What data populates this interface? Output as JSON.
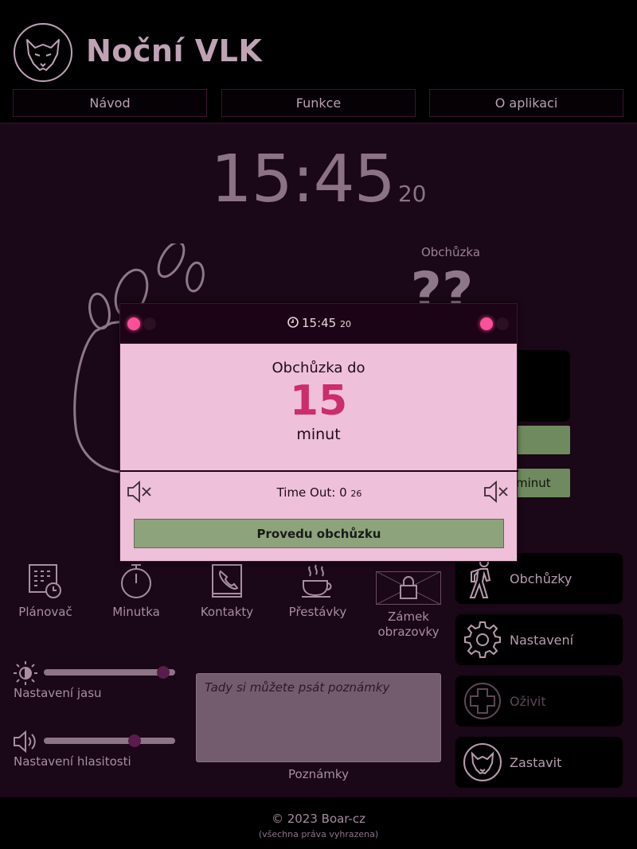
{
  "app": {
    "title": "Noční VLK"
  },
  "nav": [
    {
      "label": "Návod"
    },
    {
      "label": "Funkce"
    },
    {
      "label": "O aplikaci"
    }
  ],
  "clock": {
    "hm": "15:45",
    "sec": "20"
  },
  "obchuzka": {
    "label": "Obchůzka",
    "value": "??"
  },
  "behind_modal": {
    "minut_fragment": "minut"
  },
  "tools": [
    {
      "label": "Plánovač",
      "icon": "calendar-clock-icon"
    },
    {
      "label": "Minutka",
      "icon": "stopwatch-icon"
    },
    {
      "label": "Kontakty",
      "icon": "phone-book-icon"
    },
    {
      "label": "Přestávky",
      "icon": "coffee-cup-icon"
    },
    {
      "label": "Zámek obrazovky",
      "icon": "lock-icon"
    }
  ],
  "side_buttons": [
    {
      "label": "Obchůzky",
      "icon": "walking-person-icon"
    },
    {
      "label": "Nastavení",
      "icon": "gear-icon"
    },
    {
      "label": "Oživit",
      "icon": "medical-cross-icon",
      "disabled": true
    },
    {
      "label": "Zastavit",
      "icon": "wolf-icon"
    }
  ],
  "sliders": {
    "brightness": {
      "label": "Nastavení jasu",
      "value": 0.95
    },
    "volume": {
      "label": "Nastavení hlasitosti",
      "value": 0.71
    }
  },
  "notes": {
    "placeholder": "Tady si můžete psát poznámky",
    "label": "Poznámky"
  },
  "footer": {
    "copyright": "© 2023 Boar-cz",
    "rights": "(všechna práva vyhrazena)"
  },
  "modal": {
    "time_hm": "15:45",
    "time_sec": "20",
    "title": "Obchůzka do",
    "number": "15",
    "unit": "minut",
    "timeout_label": "Time Out: 0",
    "timeout_sec": "26",
    "action_button": "Provedu obchůzku"
  },
  "colors": {
    "accent": "#cc2d6b",
    "indicator": "#ff4f9a",
    "action": "#8da37c",
    "modal_bg": "#efc0da"
  }
}
